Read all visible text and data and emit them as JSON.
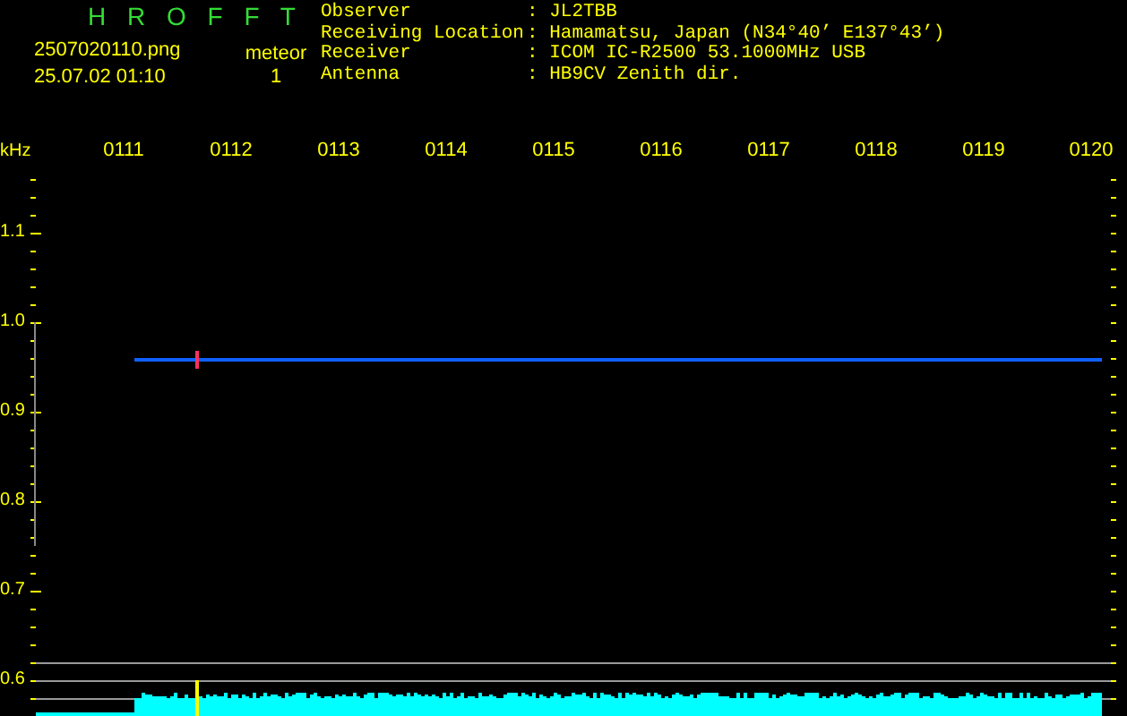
{
  "title": "H R O F F T",
  "file_name": "2507020110.png",
  "timestamp": "25.07.02 01:10",
  "counter": {
    "label": "meteor",
    "value": "1"
  },
  "info": [
    {
      "label": "Observer",
      "value": ": JL2TBB"
    },
    {
      "label": "Receiving Location",
      "value": ": Hamamatsu, Japan (N34°40’ E137°43’)"
    },
    {
      "label": "Receiver",
      "value": ": ICOM IC-R2500 53.1000MHz USB"
    },
    {
      "label": "Antenna",
      "value": ": HB9CV Zenith dir."
    }
  ],
  "axis": {
    "unit": "kHz",
    "time_ticks": [
      "0111",
      "0112",
      "0113",
      "0114",
      "0115",
      "0116",
      "0117",
      "0118",
      "0119",
      "0120"
    ],
    "freq_ticks": [
      "1.1",
      "1.0",
      "0.9",
      "0.8",
      "0.7",
      "0.6"
    ]
  }
}
